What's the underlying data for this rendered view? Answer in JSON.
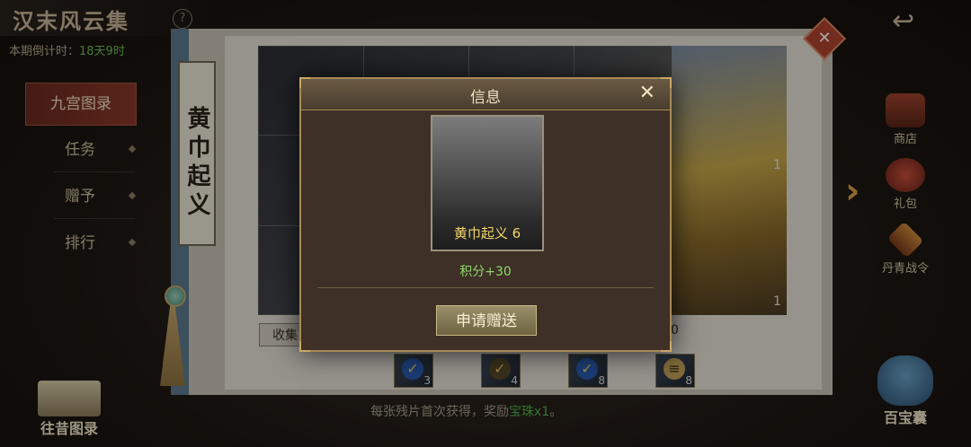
{
  "header": {
    "title": "汉末风云集",
    "help_icon": "question-icon",
    "countdown_label": "本期倒计时：",
    "countdown_value": "18天9时"
  },
  "menu": {
    "items": [
      {
        "label": "九宫图录",
        "active": true
      },
      {
        "label": "任务"
      },
      {
        "label": "赠予"
      },
      {
        "label": "排行"
      }
    ]
  },
  "album": {
    "vertical_title": "黄巾起义",
    "collect_tab": "收集",
    "collect_count": "0",
    "cell_counts": [
      "1",
      "1"
    ],
    "fragments": [
      {
        "qty": "3",
        "icon": "check-icon"
      },
      {
        "qty": "4",
        "icon": "brush-icon"
      },
      {
        "qty": "8",
        "icon": "check-icon"
      },
      {
        "qty": "8",
        "icon": "scroll-icon"
      }
    ],
    "tip_prefix": "每张残片首次获得，奖励",
    "tip_highlight": "宝珠x1",
    "tip_suffix": "。"
  },
  "side": {
    "shop": "商店",
    "gift": "礼包",
    "battle_pass": "丹青战令",
    "treasure_bag": "百宝囊",
    "past_album": "往昔图录"
  },
  "modal": {
    "title": "信息",
    "card_name": "黄巾起义 6",
    "points": "积分+30",
    "apply_button": "申请赠送"
  },
  "colors": {
    "accent_gold": "#a78a55",
    "points_green": "#8fd96a",
    "card_name_yellow": "#f3d56c",
    "active_menu_red": "#8a3a2a"
  }
}
